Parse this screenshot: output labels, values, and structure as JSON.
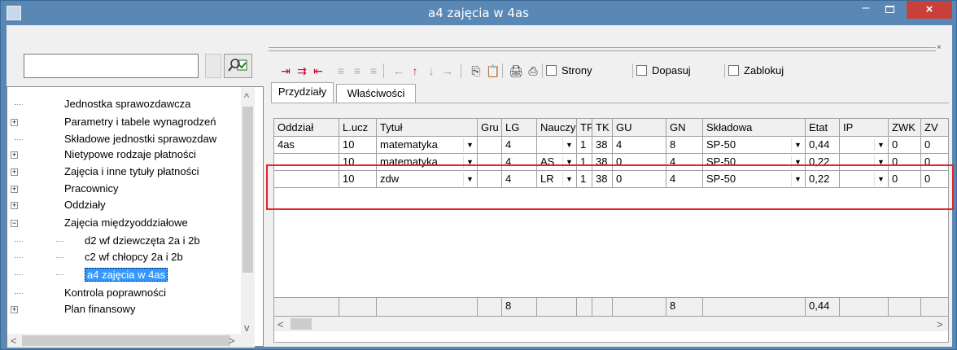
{
  "window": {
    "title": "a4 zajęcia w 4as",
    "minimize": "–",
    "close": "×"
  },
  "tree": {
    "items": [
      {
        "label": "Jednostka sprawozdawcza",
        "expander": ""
      },
      {
        "label": "Parametry i tabele wynagrodzeń",
        "expander": "+"
      },
      {
        "label": "Składowe jednostki sprawozdaw",
        "expander": ""
      },
      {
        "label": "Nietypowe rodzaje płatności",
        "expander": "+"
      },
      {
        "label": "Zajęcia i inne tytuły płatności",
        "expander": "+"
      },
      {
        "label": "Pracownicy",
        "expander": "+"
      },
      {
        "label": "Oddziały",
        "expander": "+"
      },
      {
        "label": "Zajęcia międzyoddziałowe",
        "expander": "−"
      },
      {
        "label": "d2 wf dziewczęta 2a i 2b",
        "expander": ""
      },
      {
        "label": "c2 wf chłopcy 2a i 2b",
        "expander": ""
      },
      {
        "label": "a4 zajęcia w 4as",
        "expander": "",
        "selected": true
      },
      {
        "label": "Kontrola poprawności",
        "expander": ""
      },
      {
        "label": "Plan finansowy",
        "expander": "+"
      }
    ]
  },
  "toolbar": {
    "checkboxes": [
      {
        "label": "Strony",
        "checked": false
      },
      {
        "label": "Dopasuj",
        "checked": false
      },
      {
        "label": "Zablokuj",
        "checked": false
      }
    ],
    "icons": [
      "insert-row-icon",
      "append-row-icon",
      "insert-before-icon",
      "disabled-icon-1",
      "disabled-icon-2",
      "disabled-icon-3",
      "arrow-left-icon",
      "arrow-up-icon",
      "arrow-down-icon",
      "arrow-right-icon",
      "copy-icon",
      "paste-icon",
      "print-preview-icon",
      "print-icon"
    ]
  },
  "tabs": [
    {
      "label": "Przydziały",
      "active": true
    },
    {
      "label": "Właściwości",
      "active": false
    }
  ],
  "grid": {
    "headers": [
      "Oddział",
      "L.ucz",
      "Tytuł",
      "Gru",
      "LG",
      "Nauczy",
      "TP",
      "TK",
      "GU",
      "GN",
      "Składowa",
      "Etat",
      "IP",
      "ZWK",
      "ZV"
    ],
    "rows": [
      [
        "4as",
        "10",
        "matematyka",
        "",
        "4",
        "",
        "1",
        "38",
        "4",
        "8",
        "SP-50",
        "0,44",
        "",
        "0",
        "0"
      ],
      [
        "",
        "10",
        "matematyka",
        "",
        "4",
        "AS",
        "1",
        "38",
        "0",
        "4",
        "SP-50",
        "0,22",
        "",
        "0",
        "0"
      ],
      [
        "",
        "10",
        "zdw",
        "",
        "4",
        "LR",
        "1",
        "38",
        "0",
        "4",
        "SP-50",
        "0,22",
        "",
        "0",
        "0"
      ]
    ],
    "footer": [
      "",
      "",
      "",
      "",
      "8",
      "",
      "",
      "",
      "",
      "8",
      "",
      "0,44",
      "",
      "",
      ""
    ]
  },
  "colors": {
    "titlebar": "#5a88b5",
    "close": "#c7403a",
    "selection": "#3399ff",
    "highlight": "#e3242b"
  }
}
